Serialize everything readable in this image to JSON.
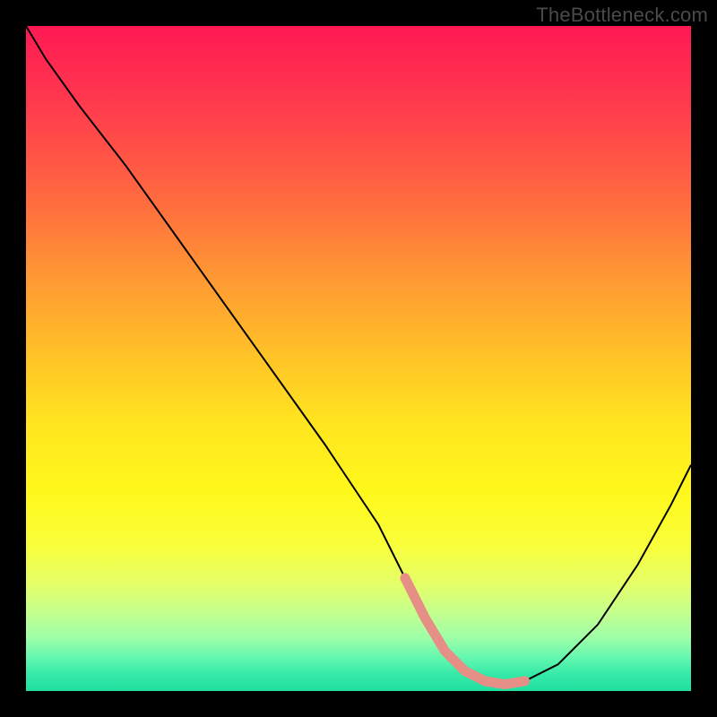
{
  "watermark": "TheBottleneck.com",
  "chart_data": {
    "type": "line",
    "title": "",
    "xlabel": "",
    "ylabel": "",
    "xlim": [
      0,
      100
    ],
    "ylim": [
      0,
      100
    ],
    "grid": false,
    "legend": false,
    "series": [
      {
        "name": "black-curve",
        "color": "#000000",
        "stroke_width": 2,
        "x": [
          0,
          3,
          8,
          15,
          25,
          35,
          45,
          53,
          57,
          60,
          63,
          66,
          69,
          72,
          75,
          80,
          86,
          92,
          97,
          100
        ],
        "values": [
          100,
          95,
          88,
          79,
          65,
          51,
          37,
          25,
          17,
          11,
          6,
          3,
          1.5,
          1,
          1.5,
          4,
          10,
          19,
          28,
          34
        ]
      },
      {
        "name": "pink-highlight",
        "color": "#e58f87",
        "stroke_width": 11,
        "x": [
          57,
          60,
          63,
          66,
          69,
          72,
          75
        ],
        "values": [
          17,
          11,
          6,
          3,
          1.5,
          1,
          1.5
        ]
      }
    ],
    "gradient_stops": [
      {
        "pos": 0.0,
        "color": "#ff1954"
      },
      {
        "pos": 0.12,
        "color": "#ff3b4d"
      },
      {
        "pos": 0.26,
        "color": "#ff6a3f"
      },
      {
        "pos": 0.38,
        "color": "#ff9933"
      },
      {
        "pos": 0.5,
        "color": "#ffc427"
      },
      {
        "pos": 0.6,
        "color": "#ffe61f"
      },
      {
        "pos": 0.7,
        "color": "#fff81b"
      },
      {
        "pos": 0.78,
        "color": "#f9ff3a"
      },
      {
        "pos": 0.84,
        "color": "#e4ff6a"
      },
      {
        "pos": 0.88,
        "color": "#c6ff8c"
      },
      {
        "pos": 0.92,
        "color": "#9effa8"
      },
      {
        "pos": 0.95,
        "color": "#63f7b0"
      },
      {
        "pos": 0.975,
        "color": "#35e9a8"
      },
      {
        "pos": 1.0,
        "color": "#1fe09f"
      }
    ]
  }
}
